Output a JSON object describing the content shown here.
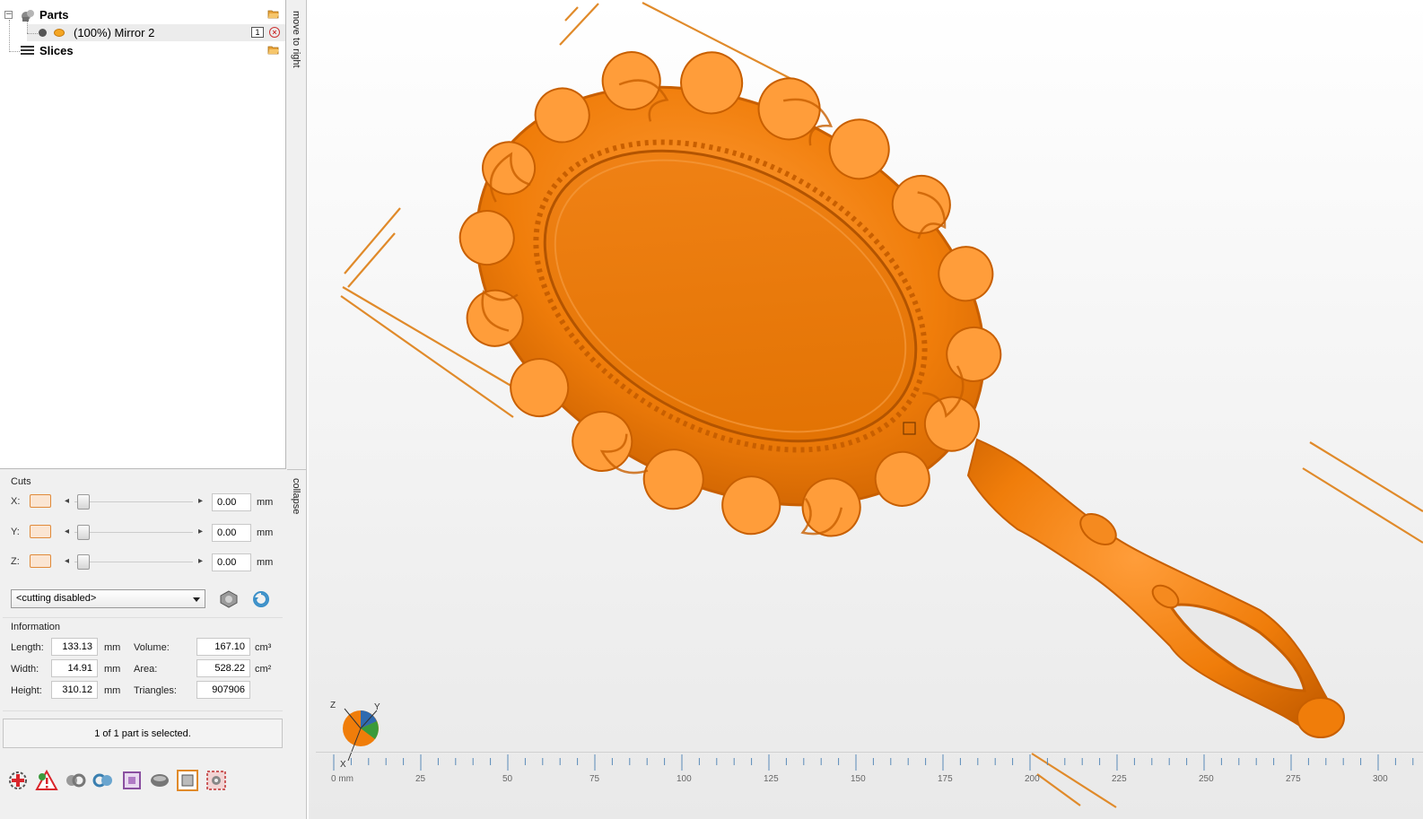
{
  "tree": {
    "parts_label": "Parts",
    "part_item_label": "(100%) Mirror 2",
    "part_item_badge": "1",
    "slices_label": "Slices",
    "expander_glyph": "−"
  },
  "side_strip": {
    "move_label": "move to right",
    "collapse_label": "collapse"
  },
  "cuts": {
    "title": "Cuts",
    "unit": "mm",
    "axes": [
      {
        "label": "X:",
        "value": "0.00"
      },
      {
        "label": "Y:",
        "value": "0.00"
      },
      {
        "label": "Z:",
        "value": "0.00"
      }
    ],
    "mode_select": "<cutting disabled>"
  },
  "information": {
    "title": "Information",
    "length_label": "Length:",
    "length_value": "133.13",
    "width_label": "Width:",
    "width_value": "14.91",
    "height_label": "Height:",
    "height_value": "310.12",
    "dim_unit": "mm",
    "volume_label": "Volume:",
    "volume_value": "167.10",
    "volume_unit": "cm³",
    "area_label": "Area:",
    "area_value": "528.22",
    "area_unit": "cm²",
    "triangles_label": "Triangles:",
    "triangles_value": "907906"
  },
  "status": {
    "selection_text": "1 of 1 part is selected."
  },
  "toolbar": {
    "icons": [
      "add-part-icon",
      "warning-icon",
      "rotate-left-icon",
      "rotate-right-icon",
      "frame-icon",
      "sphere-icon",
      "box-select-icon",
      "grid-settings-icon"
    ]
  },
  "viewport": {
    "axis_gizmo": {
      "z": "Z",
      "y": "Y",
      "x": "X"
    },
    "ruler": {
      "labels": [
        "0 mm",
        "25",
        "50",
        "75",
        "100",
        "125",
        "150",
        "175",
        "200",
        "225",
        "250",
        "275",
        "300"
      ]
    },
    "colors": {
      "model": "#f07d0a",
      "model_dark": "#c85f00",
      "model_light": "#ff9d3a",
      "guide": "#e08a2a"
    }
  }
}
